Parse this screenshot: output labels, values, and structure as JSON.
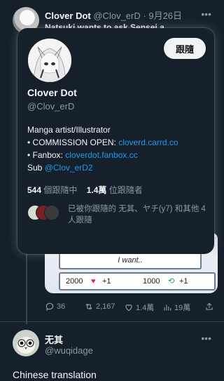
{
  "tweet": {
    "author_name": "Clover Dot",
    "author_handle": "@Clov_erD",
    "date": "9月26日",
    "text": "Natsuki wants to ask Sensei a...",
    "image": {
      "panel_text": "I want..",
      "stat1_value": "2000",
      "stat1_change": "+1",
      "stat2_value": "1000",
      "stat2_change": "+1"
    },
    "stats": {
      "replies": "36",
      "retweets": "2,167",
      "likes": "1.4萬",
      "views": "19萬"
    }
  },
  "hover_card": {
    "name": "Clover Dot",
    "handle": "@Clov_erD",
    "follow_label": "跟隨",
    "bio": {
      "line1": "Manga artist/Illustrator",
      "commission_label": "• COMMISSION OPEN: ",
      "commission_link": "cloverd.carrd.co",
      "fanbox_label": "• Fanbox: ",
      "fanbox_link": "cloverdot.fanbox.cc",
      "sub_label": "Sub ",
      "sub_link": "@Clov_erD2"
    },
    "following_count": "544",
    "following_label": "個跟隨中",
    "followers_count": "1.4萬",
    "followers_label": "位跟隨者",
    "mutual_text": "已被你跟隨的 无其、ヤチ(y7) 和其他 4 人跟隨"
  },
  "reply": {
    "author_name": "无其",
    "author_handle": "@wuqidage",
    "text": "Chinese translation"
  },
  "colors": {
    "background": "#15202b",
    "link": "#1d9bf0",
    "muted": "#8b98a5",
    "like": "#f91880",
    "retweet": "#00ba7c"
  }
}
